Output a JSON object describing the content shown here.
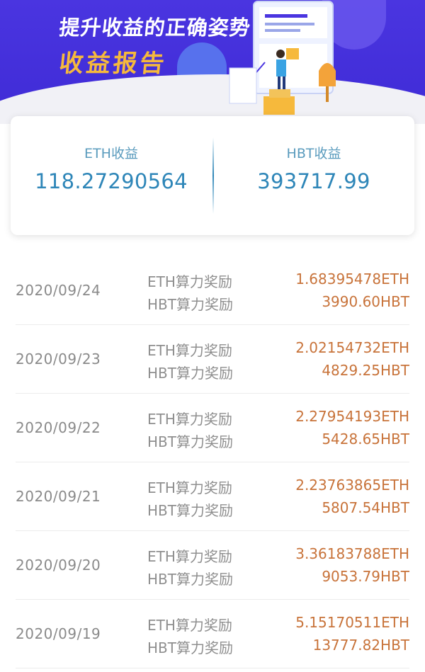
{
  "banner": {
    "title_line1": "提升收益的正确姿势",
    "title_line2": "收益报告",
    "accent_color": "#4a35e0",
    "title2_color": "#f6b93c"
  },
  "summary": {
    "eth_label": "ETH收益",
    "eth_value": "118.27290564",
    "hbt_label": "HBT收益",
    "hbt_value": "393717.99"
  },
  "records": [
    {
      "date": "2020/09/24",
      "eth_label": "ETH算力奖励",
      "eth_value": "1.68395478ETH",
      "hbt_label": "HBT算力奖励",
      "hbt_value": "3990.60HBT"
    },
    {
      "date": "2020/09/23",
      "eth_label": "ETH算力奖励",
      "eth_value": "2.02154732ETH",
      "hbt_label": "HBT算力奖励",
      "hbt_value": "4829.25HBT"
    },
    {
      "date": "2020/09/22",
      "eth_label": "ETH算力奖励",
      "eth_value": "2.27954193ETH",
      "hbt_label": "HBT算力奖励",
      "hbt_value": "5428.65HBT"
    },
    {
      "date": "2020/09/21",
      "eth_label": "ETH算力奖励",
      "eth_value": "2.23763865ETH",
      "hbt_label": "HBT算力奖励",
      "hbt_value": "5807.54HBT"
    },
    {
      "date": "2020/09/20",
      "eth_label": "ETH算力奖励",
      "eth_value": "3.36183788ETH",
      "hbt_label": "HBT算力奖励",
      "hbt_value": "9053.79HBT"
    },
    {
      "date": "2020/09/19",
      "eth_label": "ETH算力奖励",
      "eth_value": "5.15170511ETH",
      "hbt_label": "HBT算力奖励",
      "hbt_value": "13777.82HBT"
    }
  ]
}
